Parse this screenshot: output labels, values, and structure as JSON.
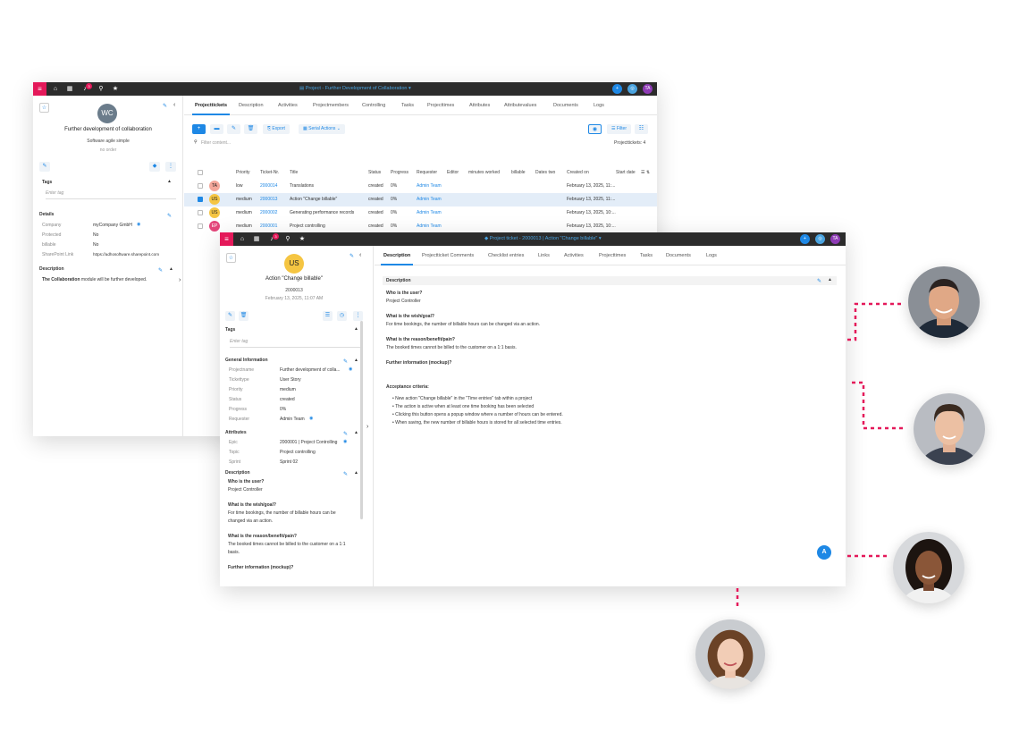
{
  "win1": {
    "title": "Project - Further Development of Collaboration",
    "notif_count": "3",
    "user_initials": "TA",
    "avatar": "WC",
    "project_name": "Further development of collaboration",
    "subtitle": "Software agile simple",
    "order": "no order",
    "tags_label": "Tags",
    "tags_placeholder": "Enter tag",
    "details_label": "Details",
    "details": [
      {
        "label": "Company",
        "value": "myCompany GmbH"
      },
      {
        "label": "Protected",
        "value": "No"
      },
      {
        "label": "billable",
        "value": "No"
      },
      {
        "label": "SharePoint Link",
        "value": "https://adhosoftware.sharepoint.com"
      }
    ],
    "description_label": "Description",
    "description_bold": "The Collaboration",
    "description_rest": " module will be further developed.",
    "tabs": [
      "Projecttickets",
      "Description",
      "Activities",
      "Projectmembers",
      "Controlling",
      "Tasks",
      "Projecttimes",
      "Attributes",
      "Attributevalues",
      "Documents",
      "Logs"
    ],
    "export_label": "Export",
    "serial_label": "Serial Actions",
    "filter_label": "Filter",
    "filter_placeholder": "Filter content...",
    "count_label": "Projecttickets: 4",
    "columns": [
      "Priority",
      "Ticket-Nr.",
      "Title",
      "Status",
      "Progress",
      "Requester",
      "Editor",
      "minutes worked",
      "billable",
      "Dates two",
      "Created on",
      "Start date"
    ],
    "rows": [
      {
        "avatar": "TA",
        "color": "#f4a79a",
        "priority": "low",
        "nr": "2000014",
        "title": "Translations",
        "status": "created",
        "progress": "0%",
        "requester": "Admin Team",
        "created": "February 13, 2025, 11:...",
        "sel": false
      },
      {
        "avatar": "US",
        "color": "#f5c542",
        "priority": "medium",
        "nr": "2000013",
        "title": "Action \"Change billable\"",
        "status": "created",
        "progress": "0%",
        "requester": "Admin Team",
        "created": "February 13, 2025, 11:...",
        "sel": true
      },
      {
        "avatar": "US",
        "color": "#f5c542",
        "priority": "medium",
        "nr": "2000002",
        "title": "Generating performance records",
        "status": "created",
        "progress": "0%",
        "requester": "Admin Team",
        "created": "February 13, 2025, 10:...",
        "sel": false
      },
      {
        "avatar": "EP",
        "color": "#e4457a",
        "priority": "medium",
        "nr": "2000001",
        "title": "Project controlling",
        "status": "created",
        "progress": "0%",
        "requester": "Admin Team",
        "created": "February 13, 2025, 10:...",
        "sel": false
      }
    ]
  },
  "win2": {
    "title": "Project ticket - 2000013 | Action \"Change billable\"",
    "notif_count": "3",
    "user_initials": "TA",
    "avatar": "US",
    "ticket_title": "Action \"Change billable\"",
    "ticket_nr": "2000013",
    "ticket_date": "February 13, 2025, 11:07 AM",
    "tags_label": "Tags",
    "tags_placeholder": "Enter tag",
    "general_label": "General Information",
    "general": [
      {
        "label": "Projectname",
        "value": "Further development of colla..."
      },
      {
        "label": "Tickettype",
        "value": "User Story"
      },
      {
        "label": "Priority",
        "value": "medium"
      },
      {
        "label": "Status",
        "value": "created"
      },
      {
        "label": "Progress",
        "value": "0%"
      },
      {
        "label": "Requester",
        "value": "Admin Team"
      }
    ],
    "attributes_label": "Attributes",
    "attributes": [
      {
        "label": "Epic",
        "value": "2000001 | Project Controlling"
      },
      {
        "label": "Topic",
        "value": "Project controlling"
      },
      {
        "label": "Sprint",
        "value": "Sprint 02"
      }
    ],
    "side_desc_label": "Description",
    "side_desc": [
      {
        "text": "Who is the user?",
        "bold": true
      },
      {
        "text": "Project Controller",
        "bold": false
      },
      {
        "text": "What is the wish/goal?",
        "bold": true
      },
      {
        "text": "For time bookings, the number of billable hours can be",
        "bold": false
      },
      {
        "text": "changed via an action.",
        "bold": false
      },
      {
        "text": "What is the reason/benefit/pain?",
        "bold": true
      },
      {
        "text": "The booked times cannot be billed to the customer on a 1:1",
        "bold": false
      },
      {
        "text": "basis.",
        "bold": false
      },
      {
        "text": "Further information (mockup)?",
        "bold": true
      }
    ],
    "tabs": [
      "Description",
      "Projectticket Comments",
      "Checklist entries",
      "Links",
      "Activities",
      "Projecttimes",
      "Tasks",
      "Documents",
      "Logs"
    ],
    "desc_header": "Description",
    "desc": [
      {
        "text": "Who is the user?",
        "bold": true
      },
      {
        "text": "Project Controller",
        "bold": false
      },
      {
        "text": "What is the wish/goal?",
        "bold": true
      },
      {
        "text": "For time bookings, the number of billable hours can be changed via an action.",
        "bold": false
      },
      {
        "text": "What is the reason/benefit/pain?",
        "bold": true
      },
      {
        "text": "The booked times cannot be billed to the customer on a 1:1 basis.",
        "bold": false
      },
      {
        "text": "Further information (mockup)?",
        "bold": true
      },
      {
        "text": "Acceptance criteria:",
        "bold": true
      }
    ],
    "criteria": [
      "New action \"Change billable\" in the \"Time entries\" tab within a project",
      "The action is active when at least one time booking has been selected",
      "Clicking this button opens a popup window where a number of hours can be entered.",
      "When saving, the new number of billable hours is stored for all selected time entries."
    ],
    "fab": "A"
  }
}
